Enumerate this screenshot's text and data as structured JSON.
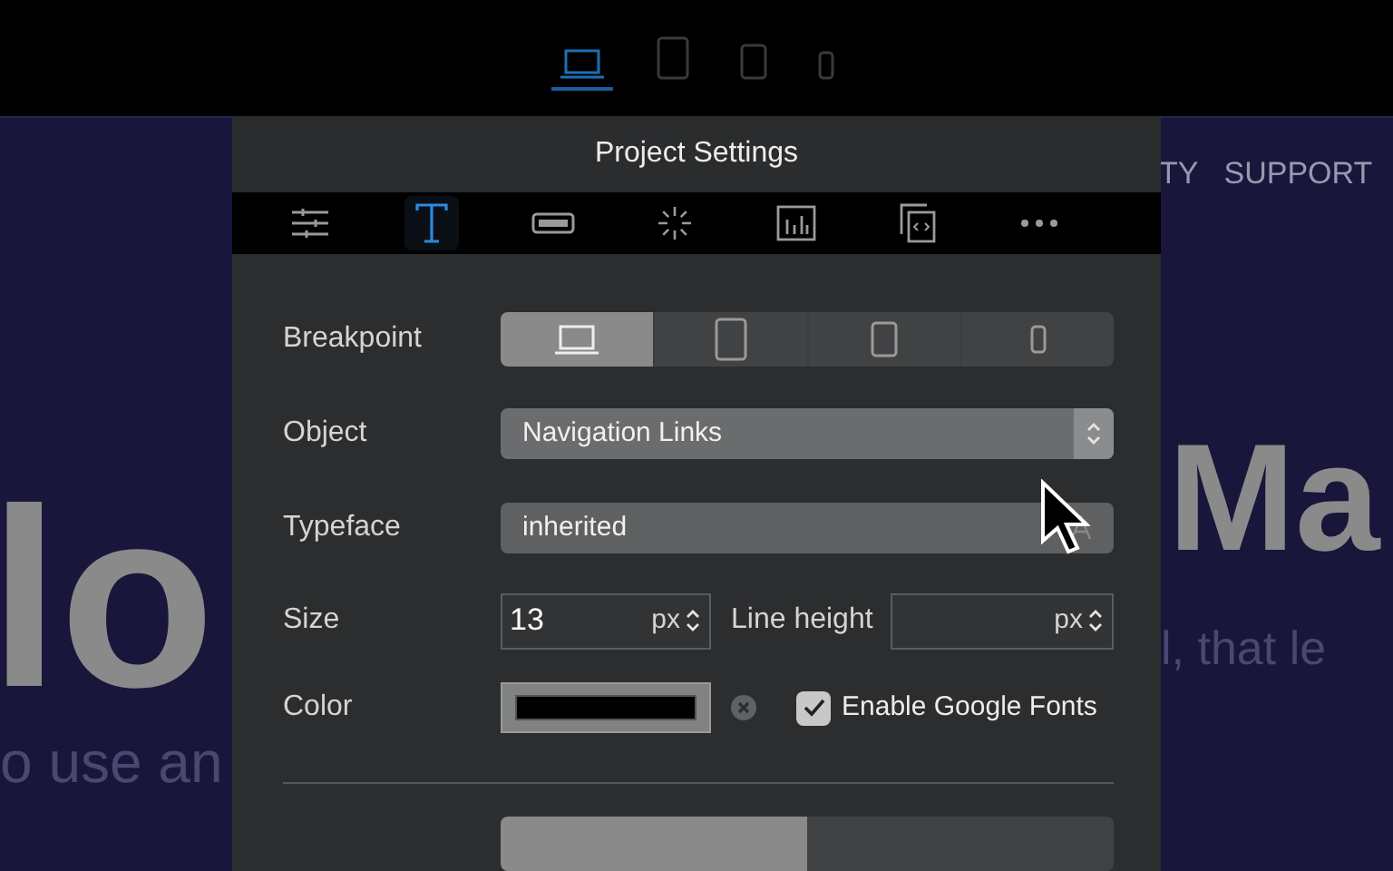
{
  "device_bar": [
    {
      "kind": "laptop",
      "selected": true
    },
    {
      "kind": "tablet",
      "selected": false
    },
    {
      "kind": "tablet-small",
      "selected": false
    },
    {
      "kind": "phone",
      "selected": false
    }
  ],
  "background": {
    "nav_left": "TY",
    "nav_right": "SUPPORT",
    "heading_left": "lo",
    "heading_right": "Ma",
    "text_left": "o use an",
    "text_right": "l, that le"
  },
  "panel": {
    "title": "Project Settings",
    "tabs": [
      {
        "kind": "sliders",
        "selected": false
      },
      {
        "kind": "text",
        "selected": true
      },
      {
        "kind": "button",
        "selected": false
      },
      {
        "kind": "spinner",
        "selected": false
      },
      {
        "kind": "chart",
        "selected": false
      },
      {
        "kind": "code",
        "selected": false
      },
      {
        "kind": "more",
        "selected": false
      }
    ],
    "breakpoint": {
      "label": "Breakpoint",
      "options": [
        {
          "kind": "laptop",
          "selected": true
        },
        {
          "kind": "tablet",
          "selected": false
        },
        {
          "kind": "tablet-small",
          "selected": false
        },
        {
          "kind": "phone",
          "selected": false
        }
      ]
    },
    "object": {
      "label": "Object",
      "value": "Navigation Links"
    },
    "typeface": {
      "label": "Typeface",
      "value": "inherited"
    },
    "size": {
      "label": "Size",
      "value": "13",
      "unit": "px"
    },
    "line_height": {
      "label": "Line height",
      "unit": "px"
    },
    "color": {
      "label": "Color",
      "color": "#000000"
    },
    "google_fonts": {
      "label": "Enable Google Fonts",
      "checked": true
    }
  }
}
